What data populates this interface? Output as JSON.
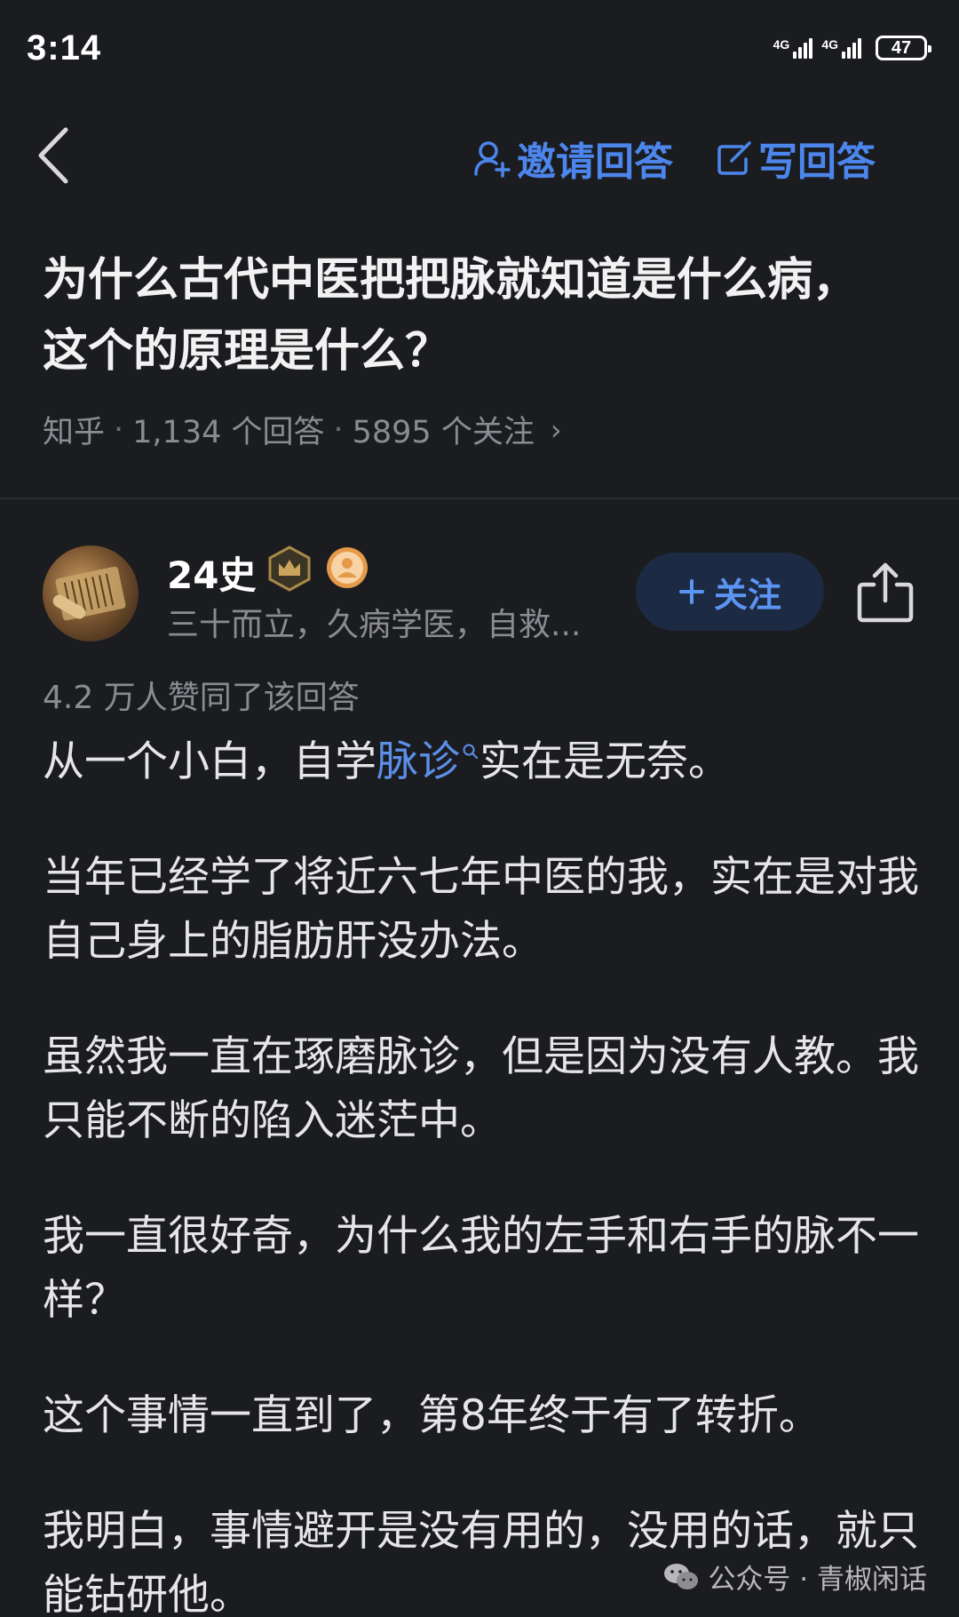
{
  "status_bar": {
    "time": "3:14",
    "network_1": "4G",
    "network_2": "4G",
    "battery": "47"
  },
  "nav": {
    "invite_label": "邀请回答",
    "write_label": "写回答"
  },
  "question": {
    "title": "为什么古代中医把把脉就知道是什么病，这个的原理是什么？",
    "source": "知乎",
    "answers": "1,134 个回答",
    "followers": "5895 个关注"
  },
  "author": {
    "name": "24史",
    "description": "三十而立，久病学医，自救...",
    "follow_label": "关注"
  },
  "answer": {
    "upvotes": "4.2 万人赞同了该回答",
    "p1_before": "从一个小白，自学",
    "p1_link": "脉诊",
    "p1_after": "实在是无奈。",
    "p2": "当年已经学了将近六七年中医的我，实在是对我自己身上的脂肪肝没办法。",
    "p3": "虽然我一直在琢磨脉诊，但是因为没有人教。我只能不断的陷入迷茫中。",
    "p4": "我一直很好奇，为什么我的左手和右手的脉不一样？",
    "p5": "这个事情一直到了，第8年终于有了转折。",
    "p6": "我明白，事情避开是没有用的，没用的话，就只能钻研他。"
  },
  "watermark": {
    "label": "公众号 · 青椒闲话"
  },
  "colors": {
    "background": "#1b1c20",
    "accent": "#4c86ec",
    "text_secondary": "#8b8c92"
  }
}
